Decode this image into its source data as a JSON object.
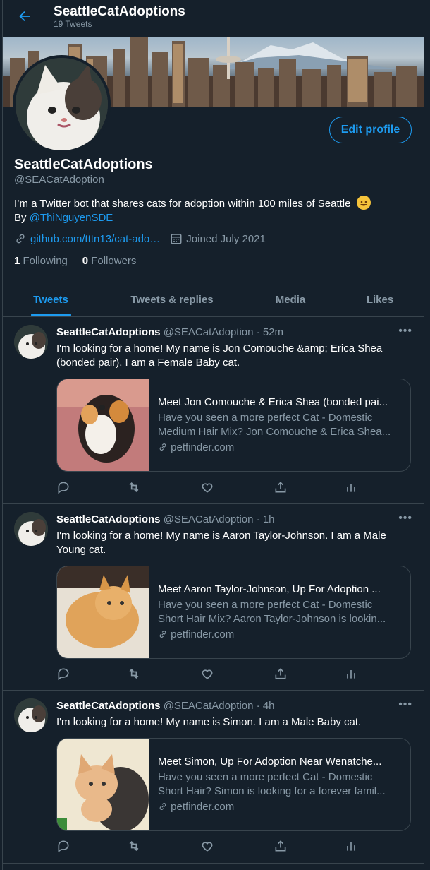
{
  "header": {
    "title": "SeattleCatAdoptions",
    "tweet_count": "19 Tweets"
  },
  "profile": {
    "name": "SeattleCatAdoptions",
    "handle": "@SEACatAdoption",
    "bio_line1": "I’m a Twitter bot that shares cats for adoption within 100 miles of Seattle",
    "bio_by": "By ",
    "bio_mention": "@ThiNguyenSDE",
    "website": "github.com/tttn13/cat-ado…",
    "joined": "Joined July 2021",
    "following_count": "1",
    "following_label": "Following",
    "followers_count": "0",
    "followers_label": "Followers",
    "edit_label": "Edit profile"
  },
  "tabs": [
    {
      "label": "Tweets"
    },
    {
      "label": "Tweets & replies"
    },
    {
      "label": "Media"
    },
    {
      "label": "Likes"
    }
  ],
  "tweets": [
    {
      "name": "SeattleCatAdoptions",
      "meta": "@SEACatAdoption · 52m",
      "text": "I'm looking for a home! My name is Jon Comouche &amp; Erica Shea (bonded pair). I am a Female Baby cat.",
      "card_title": "Meet Jon Comouche & Erica Shea (bonded pai...",
      "card_desc1": "Have you seen a more perfect Cat - Domestic",
      "card_desc2": "Medium Hair Mix? Jon Comouche & Erica Shea...",
      "card_domain": "petfinder.com"
    },
    {
      "name": "SeattleCatAdoptions",
      "meta": "@SEACatAdoption · 1h",
      "text": "I'm looking for a home! My name is Aaron Taylor-Johnson. I am a Male Young cat.",
      "card_title": "Meet Aaron Taylor-Johnson, Up For Adoption ...",
      "card_desc1": "Have you seen a more perfect Cat - Domestic",
      "card_desc2": "Short Hair Mix? Aaron Taylor-Johnson is lookin...",
      "card_domain": "petfinder.com"
    },
    {
      "name": "SeattleCatAdoptions",
      "meta": "@SEACatAdoption · 4h",
      "text": "I'm looking for a home! My name is Simon. I am a Male Baby cat.",
      "card_title": "Meet Simon, Up For Adoption Near Wenatche...",
      "card_desc1": "Have you seen a more perfect Cat - Domestic",
      "card_desc2": "Short Hair? Simon is looking for a forever famil...",
      "card_domain": "petfinder.com"
    }
  ],
  "colors": {
    "accent": "#1d9bf0",
    "background": "#15202b",
    "muted": "#8899a6",
    "border": "#38444d"
  },
  "icons": [
    "back-arrow-icon",
    "link-icon",
    "calendar-icon",
    "more-icon",
    "reply-icon",
    "retweet-icon",
    "like-icon",
    "share-icon",
    "analytics-icon",
    "emoji-grinning-cat-icon"
  ]
}
